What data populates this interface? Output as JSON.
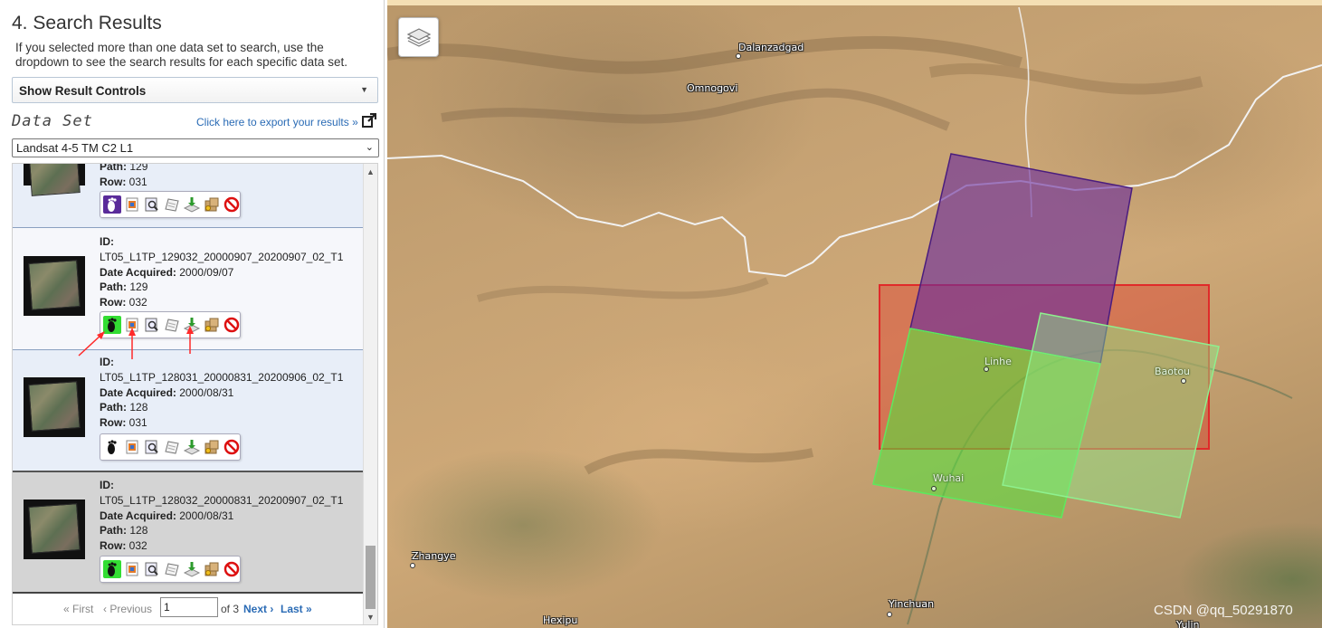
{
  "panel": {
    "title": "4. Search Results",
    "description": "If you selected more than one data set to search, use the dropdown to see the search results for each specific data set.",
    "result_controls_label": "Show Result Controls",
    "dataset_label": "Data Set",
    "export_link": "Click here to export your results »",
    "dataset_selected": "Landsat 4-5 TM C2 L1"
  },
  "results": [
    {
      "id": "",
      "date_acquired": "",
      "path": "129",
      "row": "031",
      "footprint_active": "purple"
    },
    {
      "id": "LT05_L1TP_129032_20000907_20200907_02_T1",
      "date_acquired": "2000/09/07",
      "path": "129",
      "row": "032",
      "footprint_active": "green"
    },
    {
      "id": "LT05_L1TP_128031_20000831_20200906_02_T1",
      "date_acquired": "2000/08/31",
      "path": "128",
      "row": "031",
      "footprint_active": "none"
    },
    {
      "id": "LT05_L1TP_128032_20000831_20200907_02_T1",
      "date_acquired": "2000/08/31",
      "path": "128",
      "row": "032",
      "footprint_active": "green"
    }
  ],
  "labels": {
    "id": "ID:",
    "date_acquired": "Date Acquired:",
    "path": "Path:",
    "row": "Row:"
  },
  "toolbar_icons": [
    "footprint-icon",
    "overlay-icon",
    "metadata-icon",
    "compare-icon",
    "download-icon",
    "order-icon",
    "exclude-icon"
  ],
  "pager": {
    "first": "« First",
    "previous": "‹ Previous",
    "page_value": "1",
    "of_text": "of 3",
    "next": "Next ›",
    "last": "Last »"
  },
  "map": {
    "cities": [
      {
        "name": "Dalanzadgad",
        "style": "dark"
      },
      {
        "name": "Omnogovi",
        "style": "dark"
      },
      {
        "name": "Linhe",
        "style": "light"
      },
      {
        "name": "Baotou",
        "style": "light"
      },
      {
        "name": "Wuhai",
        "style": "light"
      },
      {
        "name": "Zhangye",
        "style": "dark"
      },
      {
        "name": "Yinchuan",
        "style": "dark"
      },
      {
        "name": "Hexipu",
        "style": "dark"
      },
      {
        "name": "Yulin",
        "style": "dark"
      }
    ],
    "footprint_colors": {
      "purple": "#6a2c9c",
      "red": "#e02a2a",
      "green": "#5ee85e",
      "light_green": "#8ef08e"
    },
    "watermark": "CSDN @qq_50291870"
  },
  "accent_color": "#2a6bb5"
}
